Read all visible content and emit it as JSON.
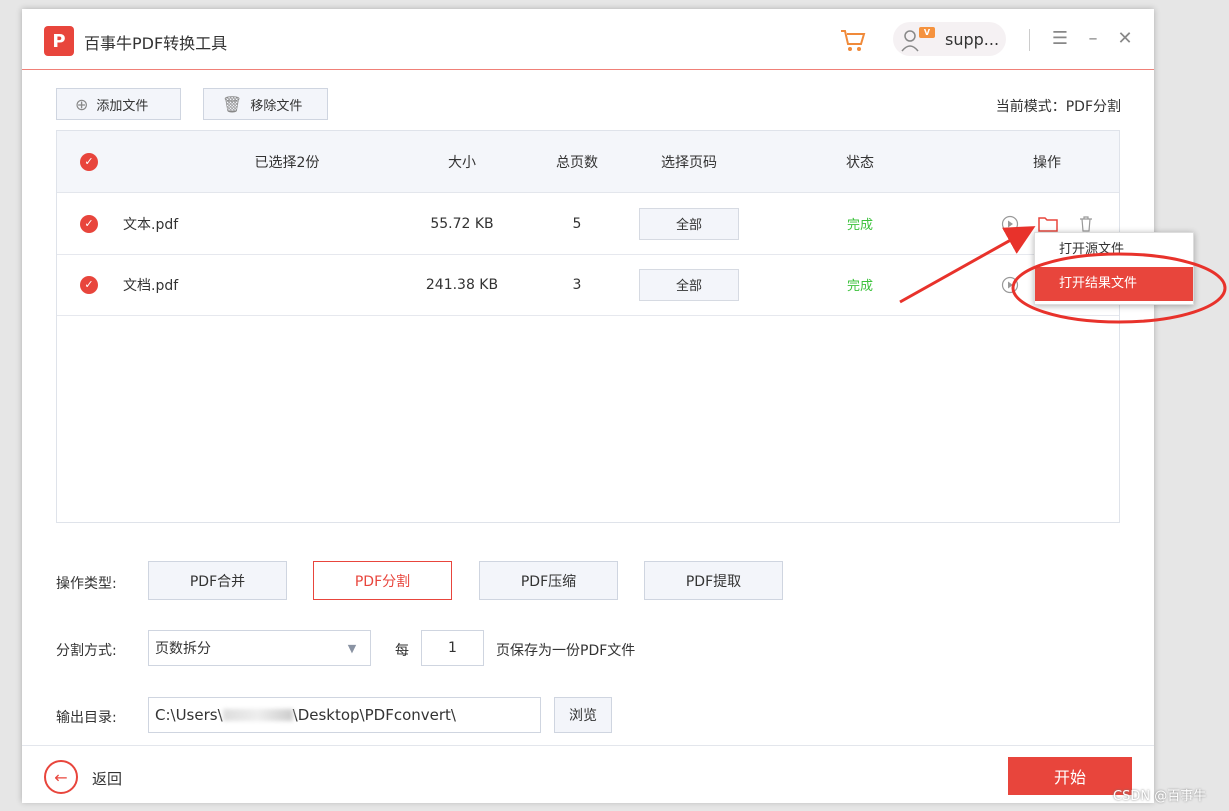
{
  "app": {
    "title": "百事牛PDF转换工具",
    "logo_letter": "P",
    "user_name": "supp...",
    "vip_badge": "V"
  },
  "toolbar": {
    "add_file": "添加文件",
    "remove_file": "移除文件",
    "mode_text": "当前模式：PDF分割"
  },
  "table": {
    "headers": {
      "selected": "已选择2份",
      "size": "大小",
      "pages": "总页数",
      "page_select": "选择页码",
      "status": "状态",
      "actions": "操作"
    },
    "rows": [
      {
        "name": "文本.pdf",
        "size": "55.72 KB",
        "pages": "5",
        "page_select": "全部",
        "status": "完成"
      },
      {
        "name": "文档.pdf",
        "size": "241.38 KB",
        "pages": "3",
        "page_select": "全部",
        "status": "完成"
      }
    ]
  },
  "context_menu": {
    "items": [
      "打开源文件",
      "打开结果文件"
    ],
    "highlighted_index": 1
  },
  "operation": {
    "label": "操作类型:",
    "types": [
      "PDF合并",
      "PDF分割",
      "PDF压缩",
      "PDF提取"
    ],
    "selected": "PDF分割"
  },
  "split": {
    "label": "分割方式:",
    "method": "页数拆分",
    "every_label": "每",
    "every_value": "1",
    "suffix": "页保存为一份PDF文件"
  },
  "output": {
    "label": "输出目录:",
    "path_prefix": "C:\\Users\\",
    "path_suffix": "\\Desktop\\PDFconvert\\",
    "browse": "浏览"
  },
  "footer": {
    "back": "返回",
    "start": "开始"
  },
  "watermark": "CSDN @百事牛",
  "colors": {
    "accent": "#e8453c",
    "success": "#3cc23c",
    "annotation": "#e8322b"
  }
}
